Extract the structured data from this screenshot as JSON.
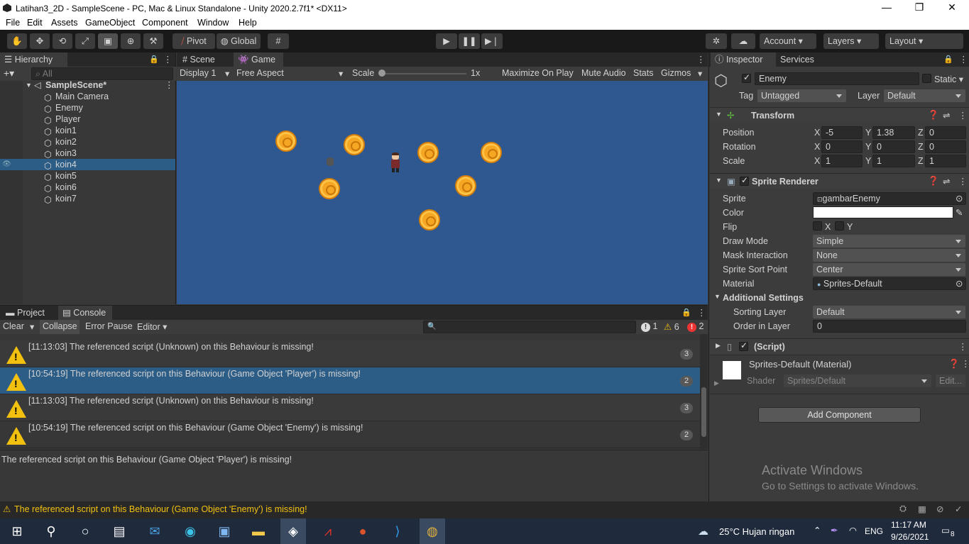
{
  "window": {
    "title": "Latihan3_2D - SampleScene - PC, Mac & Linux Standalone - Unity 2020.2.7f1* <DX11>"
  },
  "menu": [
    "File",
    "Edit",
    "Assets",
    "GameObject",
    "Component",
    "Window",
    "Help"
  ],
  "toolbar": {
    "pivot": "Pivot",
    "global": "Global",
    "account": "Account",
    "layers": "Layers",
    "layout": "Layout"
  },
  "hierarchy": {
    "tab": "Hierarchy",
    "search_placeholder": "All",
    "scene": "SampleScene*",
    "items": [
      "Main Camera",
      "Enemy",
      "Player",
      "koin1",
      "koin2",
      "koin3",
      "koin4",
      "koin5",
      "koin6",
      "koin7"
    ],
    "selected": "koin4"
  },
  "game": {
    "tabs": [
      "Scene",
      "Game"
    ],
    "display": "Display 1",
    "aspect": "Free Aspect",
    "scale_label": "Scale",
    "scale_value": "1x",
    "maximize": "Maximize On Play",
    "mute": "Mute Audio",
    "stats": "Stats",
    "gizmos": "Gizmos",
    "bg": "#2f5790"
  },
  "console": {
    "tabs": [
      "Project",
      "Console"
    ],
    "clear": "Clear",
    "collapse": "Collapse",
    "error_pause": "Error Pause",
    "editor": "Editor",
    "info_count": "1",
    "warn_count": "6",
    "error_count": "2",
    "rows": [
      {
        "text": "[11:13:03] The referenced script (Unknown) on this Behaviour is missing!",
        "count": "3"
      },
      {
        "text": "[10:54:19] The referenced script on this Behaviour (Game Object 'Player') is missing!",
        "count": "2"
      },
      {
        "text": "[11:13:03] The referenced script (Unknown) on this Behaviour is missing!",
        "count": "3"
      },
      {
        "text": "[10:54:19] The referenced script on this Behaviour (Game Object 'Enemy') is missing!",
        "count": "2"
      }
    ],
    "detail": "The referenced script on this Behaviour (Game Object 'Player') is missing!"
  },
  "status": {
    "message": "The referenced script on this Behaviour (Game Object 'Enemy') is missing!"
  },
  "inspector": {
    "tabs": [
      "Inspector",
      "Services"
    ],
    "object_name": "Enemy",
    "static": "Static",
    "tag_label": "Tag",
    "tag": "Untagged",
    "layer_label": "Layer",
    "layer": "Default",
    "transform": {
      "title": "Transform",
      "position": "Position",
      "rotation": "Rotation",
      "scale": "Scale",
      "px": "-5",
      "py": "1.38",
      "pz": "0",
      "rx": "0",
      "ry": "0",
      "rz": "0",
      "sx": "1",
      "sy": "1",
      "sz": "1",
      "x": "X",
      "y": "Y",
      "z": "Z"
    },
    "sprite_renderer": {
      "title": "Sprite Renderer",
      "sprite_label": "Sprite",
      "sprite": "gambarEnemy",
      "color_label": "Color",
      "flip_label": "Flip",
      "flip_x": "X",
      "flip_y": "Y",
      "draw_mode_label": "Draw Mode",
      "draw_mode": "Simple",
      "mask_label": "Mask Interaction",
      "mask": "None",
      "sort_point_label": "Sprite Sort Point",
      "sort_point": "Center",
      "material_label": "Material",
      "material": "Sprites-Default",
      "additional": "Additional Settings",
      "sorting_layer_label": "Sorting Layer",
      "sorting_layer": "Default",
      "order_label": "Order in Layer",
      "order": "0"
    },
    "script": "(Script)",
    "material_name": "Sprites-Default (Material)",
    "shader_label": "Shader",
    "shader": "Sprites/Default",
    "edit": "Edit...",
    "add_component": "Add Component",
    "activate_title": "Activate Windows",
    "activate_sub": "Go to Settings to activate Windows."
  },
  "taskbar": {
    "weather": "25°C  Hujan ringan",
    "lang": "ENG",
    "time": "11:17 AM",
    "date": "9/26/2021",
    "notif": "8"
  }
}
